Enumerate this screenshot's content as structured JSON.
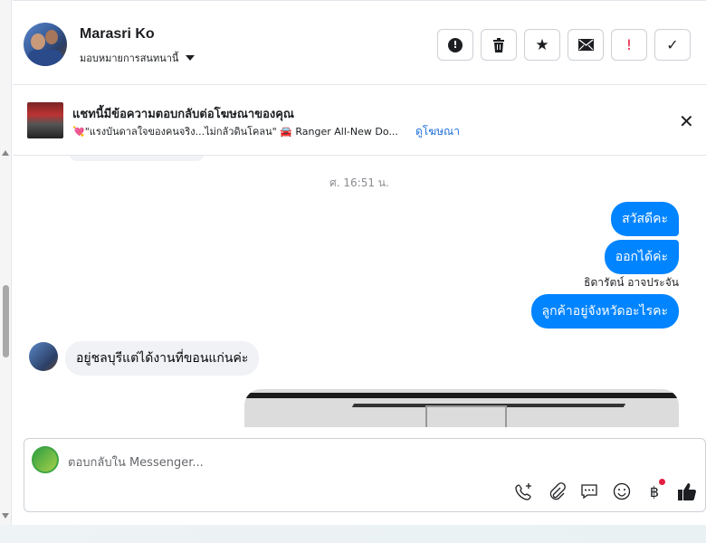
{
  "header": {
    "name": "Marasri Ko",
    "assign_label": "มอบหมายการสนทนานี้",
    "actions": [
      {
        "icon": "alert-circle-icon",
        "glyph": "❗"
      },
      {
        "icon": "trash-icon",
        "glyph": "🗑"
      },
      {
        "icon": "star-icon",
        "glyph": "★"
      },
      {
        "icon": "envelope-icon",
        "glyph": "✉"
      },
      {
        "icon": "exclamation-icon",
        "glyph": "!"
      },
      {
        "icon": "check-icon",
        "glyph": "✓"
      }
    ]
  },
  "ad": {
    "title": "แชทนี้มีข้อความตอบกลับต่อโฆษณาของคุณ",
    "subtitle": "💘\"แรงบันดาลใจของคนจริง...ไม่กลัวดินโคลน\" 🚘 Ranger All-New Do...",
    "link": "ดูโฆษณา"
  },
  "chat": {
    "timestamp": "ศ. 16:51 น.",
    "outgoing": [
      "สวัสดีคะ",
      "ออกได้ค่ะ",
      "ลูกค้าอยู่จังหวัดอะไรคะ"
    ],
    "sender_name": "ธิดารัตน์ อาจประจัน",
    "incoming": "อยู่ชลบุรีแต่ได้งานที่ขอนแก่นค่ะ"
  },
  "composer": {
    "placeholder": "ตอบกลับใน Messenger...",
    "tools": [
      {
        "icon": "phone-plus-icon",
        "glyph": "📞"
      },
      {
        "icon": "paperclip-icon",
        "glyph": "📎"
      },
      {
        "icon": "chat-bubble-icon",
        "glyph": "💬"
      },
      {
        "icon": "emoji-icon",
        "glyph": "☺"
      },
      {
        "icon": "baht-icon",
        "glyph": "฿"
      },
      {
        "icon": "thumbs-up-icon",
        "glyph": "👍"
      }
    ]
  },
  "colors": {
    "outgoing_bubble": "#0084ff",
    "incoming_bubble": "#f0f2f5",
    "link": "#216fdb",
    "notification_dot": "#e41e3f"
  }
}
